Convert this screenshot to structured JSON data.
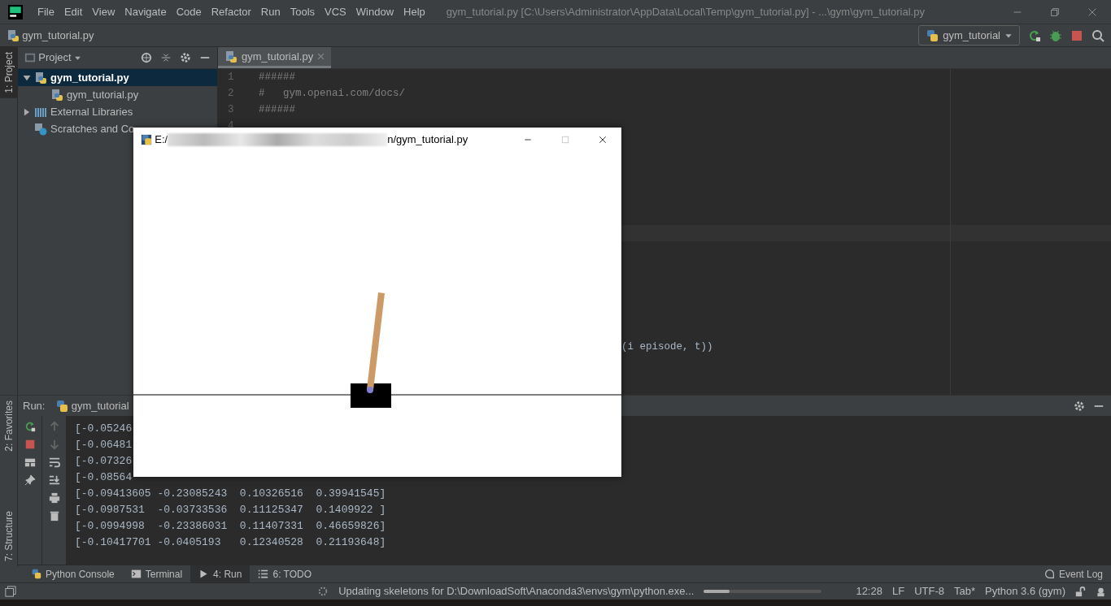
{
  "menu_bar": {
    "items": [
      "File",
      "Edit",
      "View",
      "Navigate",
      "Code",
      "Refactor",
      "Run",
      "Tools",
      "VCS",
      "Window",
      "Help"
    ],
    "title": "gym_tutorial.py [C:\\Users\\Administrator\\AppData\\Local\\Temp\\gym_tutorial.py] - ...\\gym\\gym_tutorial.py"
  },
  "breadcrumb": "gym_tutorial.py",
  "run_config": "gym_tutorial",
  "side_tabs": [
    {
      "label": "1: Project",
      "selected": true
    },
    {
      "label": "2: Favorites",
      "selected": false
    },
    {
      "label": "7: Structure",
      "selected": false
    }
  ],
  "project": {
    "title": "Project",
    "tree": [
      {
        "label": "gym_tutorial.py",
        "kind": "folder",
        "expanded": true,
        "selected": true,
        "children": [
          {
            "label": "gym_tutorial.py",
            "kind": "file",
            "selected": false
          }
        ]
      },
      {
        "label": "External Libraries",
        "kind": "library",
        "expanded": false,
        "selected": false
      },
      {
        "label": "Scratches and Co",
        "kind": "scratch",
        "selected": false
      }
    ]
  },
  "editor": {
    "tabs": [
      {
        "label": "gym_tutorial.py",
        "selected": true
      }
    ],
    "lines": [
      {
        "number": "1",
        "text": "######"
      },
      {
        "number": "2",
        "text": "#   gym.openai.com/docs/"
      },
      {
        "number": "3",
        "text": "######"
      },
      {
        "number": "4"
      }
    ],
    "fragment": "(i episode, t))"
  },
  "run_panel": {
    "title": "Run:",
    "tab": "gym_tutorial",
    "output": [
      "[-0.05246",
      "[-0.06481",
      "[-0.07326",
      "[-0.08564",
      "[-0.09413605 -0.23085243  0.10326516  0.39941545]",
      "[-0.0987531  -0.03733536  0.11125347  0.1409922 ]",
      "[-0.0994998  -0.23386031  0.11407331  0.46659826]",
      "[-0.10417701 -0.0405193   0.12340528  0.21193648]"
    ]
  },
  "bottom_tabs": [
    {
      "label": "Python Console",
      "kind": "console",
      "selected": false
    },
    {
      "label": "Terminal",
      "kind": "terminal",
      "selected": false
    },
    {
      "label": "4: Run",
      "kind": "run",
      "selected": true
    },
    {
      "label": "6: TODO",
      "kind": "todo",
      "selected": false
    }
  ],
  "event_log": "Event Log",
  "status_bar": {
    "message": "Updating skeletons for D:\\DownloadSoft\\Anaconda3\\envs\\gym\\python.exe...",
    "level": 0.22,
    "items": [
      "12:28",
      "LF",
      "UTF-8",
      "Tab*",
      "Python 3.6 (gym)"
    ]
  },
  "popup": {
    "title_start": "E:/",
    "title_end": "n/gym_tutorial.py"
  }
}
